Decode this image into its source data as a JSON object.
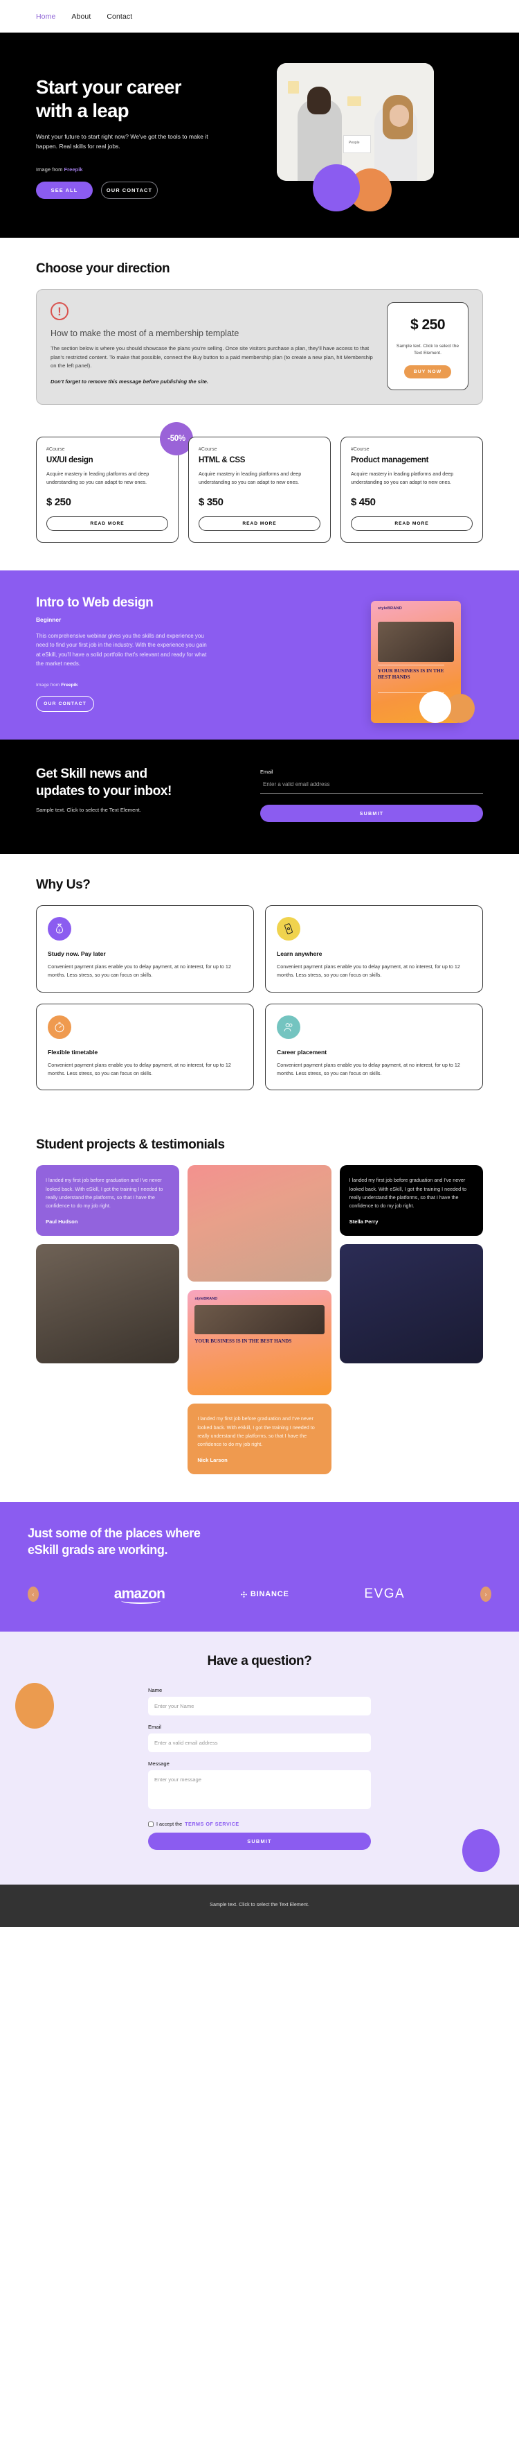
{
  "nav": {
    "items": [
      {
        "label": "Home",
        "active": true
      },
      {
        "label": "About",
        "active": false
      },
      {
        "label": "Contact",
        "active": false
      }
    ]
  },
  "hero": {
    "title_line1": "Start your career",
    "title_line2": "with a leap",
    "subtitle": "Want your future to start right now? We've got the tools to make it happen. Real skills for real jobs.",
    "credit_prefix": "Image from ",
    "credit_source": "Freepik",
    "btn_primary": "SEE ALL",
    "btn_secondary": "OUR CONTACT",
    "photo_board_text": "People"
  },
  "direction": {
    "title": "Choose your direction",
    "notice_heading": "How to make the most of a membership template",
    "notice_body": "The section below is where you should showcase the plans you're selling. Once site visitors purchase a plan, they'll have access to that plan's restricted content. To make that possible, connect the Buy button to a paid membership plan (to create a new plan, hit Membership on the left panel).",
    "notice_warning": "Don't forget to remove this message before publishing the site.",
    "price": "$ 250",
    "price_sub": "Sample text. Click to select the Text Element.",
    "buy_label": "BUY NOW"
  },
  "courses": {
    "badge": "-50%",
    "read_more": "READ MORE",
    "items": [
      {
        "tag": "#Course",
        "title": "UX/UI design",
        "desc": "Acquire mastery in leading platforms and deep understanding so you can adapt to new ones.",
        "price": "$ 250"
      },
      {
        "tag": "#Course",
        "title": "HTML & CSS",
        "desc": "Acquire mastery in leading platforms and deep understanding so you can adapt to new ones.",
        "price": "$ 350"
      },
      {
        "tag": "#Course",
        "title": "Product management",
        "desc": "Acquire mastery in leading platforms and deep understanding so you can adapt to new ones.",
        "price": "$ 450"
      }
    ]
  },
  "intro": {
    "title": "Intro to Web design",
    "level": "Beginner",
    "body": "This comprehensive webinar gives you the skills and experience you need to find your first job in the industry. With the experience you gain at eSkill, you'll have a solid portfolio that's relevant and ready for what the market needs.",
    "credit_prefix": "Image from ",
    "credit_source": "Freepik",
    "btn_label": "OUR CONTACT",
    "poster_brand": "styleBRAND",
    "poster_heading": "YOUR BUSINESS IS IN THE BEST HANDS"
  },
  "newsletter": {
    "title_line1": "Get Skill news and",
    "title_line2": "updates to your inbox!",
    "subtitle": "Sample text. Click to select the Text Element.",
    "email_label": "Email",
    "email_placeholder": "Enter a valid email address",
    "email_value": "",
    "submit_label": "SUBMIT"
  },
  "why": {
    "title": "Why Us?",
    "cards": [
      {
        "icon": "money-bag-icon",
        "icon_bg": "#8b5cf0",
        "title": "Study now. Pay later",
        "desc": "Convenient payment plans enable you to delay payment, at no interest, for up to 12 months. Less stress, so you can focus on skills."
      },
      {
        "icon": "mobile-device-icon",
        "icon_bg": "#f0d34e",
        "title": "Learn anywhere",
        "desc": "Convenient payment plans enable you to delay payment, at no interest, for up to 12 months. Less stress, so you can focus on skills."
      },
      {
        "icon": "stopwatch-icon",
        "icon_bg": "#ef9a4f",
        "title": "Flexible timetable",
        "desc": "Convenient payment plans enable you to delay payment, at no interest, for up to 12 months. Less stress, so you can focus on skills."
      },
      {
        "icon": "people-icon",
        "icon_bg": "#74c4c0",
        "title": "Career placement",
        "desc": "Convenient payment plans enable you to delay payment, at no interest, for up to 12 months. Less stress, so you can focus on skills."
      }
    ]
  },
  "testimonials": {
    "title": "Student projects & testimonials",
    "quote_text": "I landed my first job before graduation and I've never looked back. With eSkill, I got the training I needed to really understand the platforms, so that I have the confidence to do my job right.",
    "authors": {
      "first": "Paul Hudson",
      "second": "Stella Perry",
      "third": "Nick Larson"
    },
    "poster_brand": "styleBRAND",
    "poster_heading": "YOUR BUSINESS IS IN THE BEST HANDS"
  },
  "brands": {
    "title_line1": "Just some of the places where",
    "title_line2": "eSkill grads are working.",
    "prev_icon": "chevron-left-icon",
    "next_icon": "chevron-right-icon",
    "logos": [
      {
        "name": "amazon"
      },
      {
        "name": "BINANCE"
      },
      {
        "name": "EVGA"
      }
    ]
  },
  "contact": {
    "title": "Have a question?",
    "name_label": "Name",
    "name_placeholder": "Enter your Name",
    "name_value": "",
    "email_label": "Email",
    "email_placeholder": "Enter a valid email address",
    "email_value": "",
    "message_label": "Message",
    "message_placeholder": "Enter your message",
    "message_value": "",
    "accept_prefix": "I accept the ",
    "tos_label": "TERMS OF SERVICE",
    "submit_label": "SUBMIT"
  },
  "footer": {
    "text": "Sample text. Click to select the Text Element."
  },
  "colors": {
    "purple": "#8b5cf0",
    "orange": "#eb9b4f",
    "black": "#000000",
    "teal": "#74c4c0",
    "yellow": "#f0d34e",
    "alert_red": "#d9534f"
  }
}
